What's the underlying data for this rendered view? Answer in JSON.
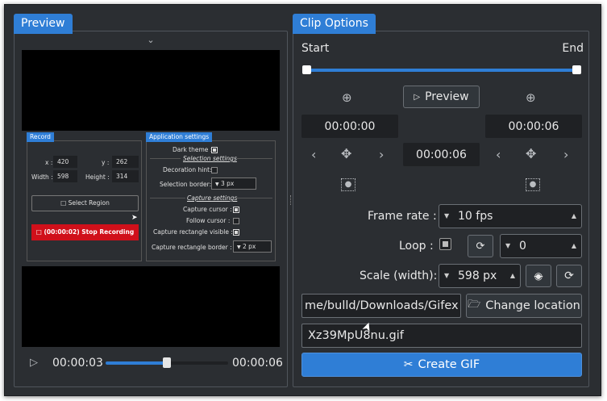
{
  "preview": {
    "title": "Preview",
    "collapse_icon": "chevron-down-icon",
    "player": {
      "current_time": "00:00:03",
      "total_time": "00:00:06",
      "progress_fraction": 0.5
    },
    "captured_frame": {
      "record_group": {
        "title": "Record",
        "x_label": "x :",
        "x_value": "420",
        "y_label": "y :",
        "y_value": "262",
        "width_label": "Width :",
        "width_value": "598",
        "height_label": "Height :",
        "height_value": "314",
        "select_region": "Select Region",
        "stop_recording": "(00:00:02) Stop Recording"
      },
      "app_settings_group": {
        "title": "Application settings",
        "dark_theme": "Dark theme :",
        "selection_settings": "Selection settings",
        "decoration_hint": "Decoration hint:",
        "selection_border": "Selection border:",
        "selection_border_value": "3 px",
        "capture_settings": "Capture settings",
        "capture_cursor": "Capture cursor :",
        "follow_cursor": "Follow cursor :",
        "capture_rect_visible": "Capture rectangle visible :",
        "capture_rect_border": "Capture rectangle border :",
        "capture_rect_border_value": "2 px"
      }
    }
  },
  "clip_options": {
    "title": "Clip Options",
    "start_label": "Start",
    "end_label": "End",
    "preview_button": "Preview",
    "start_time": "00:00:00",
    "end_time": "00:00:06",
    "duration": "00:00:06",
    "frame_rate_label": "Frame rate :",
    "frame_rate_value": "10 fps",
    "loop_label": "Loop :",
    "loop_count": "0",
    "scale_label": "Scale (width):",
    "scale_value": "598 px",
    "path_value": "me/bulld/Downloads/Gifex",
    "change_location": "Change location",
    "filename": "Xz39MpU8nu.gif",
    "create_gif": "Create GIF"
  },
  "colors": {
    "accent": "#2f7ed6",
    "stop_red": "#d0101a",
    "background": "#2b2e32"
  }
}
